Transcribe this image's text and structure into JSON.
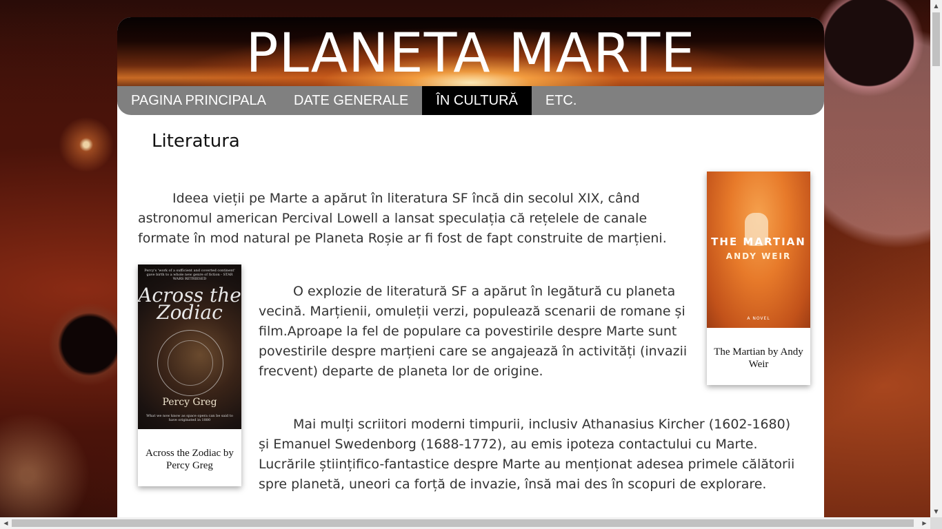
{
  "header": {
    "title": "PLANETA MARTE"
  },
  "nav": {
    "items": [
      {
        "label": "PAGINA PRINCIPALA"
      },
      {
        "label": "DATE GENERALE"
      },
      {
        "label": "ÎN CULTURĂ"
      },
      {
        "label": "ETC."
      }
    ],
    "active": "ÎN CULTURĂ"
  },
  "main": {
    "section_title": "Literatura",
    "paragraphs": [
      "Ideea vieții pe Marte a apărut în literatura SF încă din secolul XIX, când astronomul american Percival Lowell a lansat speculația că rețelele de canale formate în mod natural pe Planeta Roșie ar fi fost de fapt construite de marțieni.",
      "O explozie de literatură SF a apărut în legătură cu planeta vecină. Marțienii, omuleții verzi, populează scenarii de romane și film.Aproape la fel de populare ca povestirile despre Marte sunt povestirile despre marțieni care se angajează în activități (invazii frecvent) departe de planeta lor de origine.",
      "Mai mulți scriitori moderni timpurii, inclusiv Athanasius Kircher (1602-1680) și Emanuel Swedenborg (1688-1772), au emis ipoteza contactului cu Marte. Lucrările științifico-fantastice despre Marte au menționat adesea primele călătorii spre planetă, uneori ca forță de invazie, însă mai des în scopuri de explorare."
    ],
    "figures": [
      {
        "caption": "The Martian by Andy Weir",
        "cover_title": "THE MARTIAN",
        "cover_author": "ANDY WEIR",
        "cover_note": "A NOVEL"
      },
      {
        "caption": "Across the Zodiac by Percy Greg",
        "cover_blurb": "Percy's 'work of a sufficient and coverted continent' gave birth to a whole new genre of fiction - STAR WARS RETRIESED",
        "cover_title": "Across the Zodiac",
        "cover_author": "Percy Greg",
        "cover_note": "What we now know as space opera can be said to have originated in 1880"
      }
    ]
  },
  "scrollbars": {
    "up": "▲",
    "down": "▼",
    "left": "◀",
    "right": "▶"
  }
}
